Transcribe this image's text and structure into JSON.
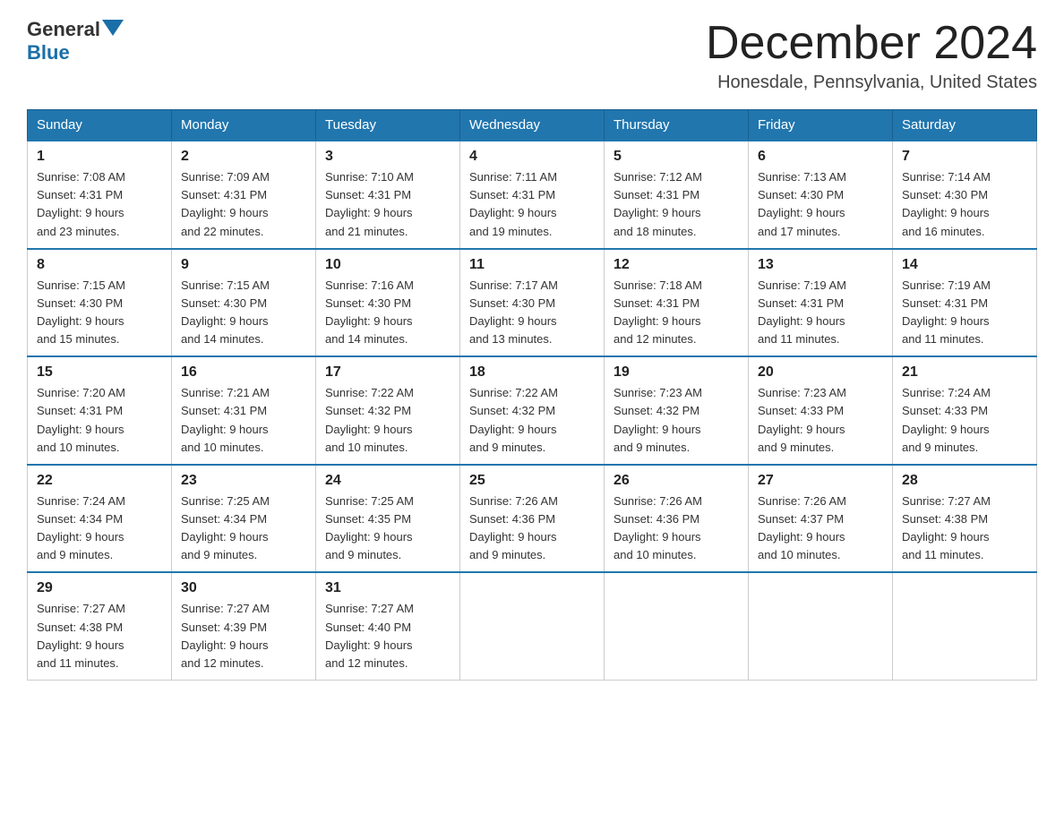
{
  "header": {
    "logo_general": "General",
    "logo_blue": "Blue",
    "title": "December 2024",
    "subtitle": "Honesdale, Pennsylvania, United States"
  },
  "days_of_week": [
    "Sunday",
    "Monday",
    "Tuesday",
    "Wednesday",
    "Thursday",
    "Friday",
    "Saturday"
  ],
  "weeks": [
    [
      {
        "day": "1",
        "sunrise": "7:08 AM",
        "sunset": "4:31 PM",
        "daylight": "9 hours and 23 minutes."
      },
      {
        "day": "2",
        "sunrise": "7:09 AM",
        "sunset": "4:31 PM",
        "daylight": "9 hours and 22 minutes."
      },
      {
        "day": "3",
        "sunrise": "7:10 AM",
        "sunset": "4:31 PM",
        "daylight": "9 hours and 21 minutes."
      },
      {
        "day": "4",
        "sunrise": "7:11 AM",
        "sunset": "4:31 PM",
        "daylight": "9 hours and 19 minutes."
      },
      {
        "day": "5",
        "sunrise": "7:12 AM",
        "sunset": "4:31 PM",
        "daylight": "9 hours and 18 minutes."
      },
      {
        "day": "6",
        "sunrise": "7:13 AM",
        "sunset": "4:30 PM",
        "daylight": "9 hours and 17 minutes."
      },
      {
        "day": "7",
        "sunrise": "7:14 AM",
        "sunset": "4:30 PM",
        "daylight": "9 hours and 16 minutes."
      }
    ],
    [
      {
        "day": "8",
        "sunrise": "7:15 AM",
        "sunset": "4:30 PM",
        "daylight": "9 hours and 15 minutes."
      },
      {
        "day": "9",
        "sunrise": "7:15 AM",
        "sunset": "4:30 PM",
        "daylight": "9 hours and 14 minutes."
      },
      {
        "day": "10",
        "sunrise": "7:16 AM",
        "sunset": "4:30 PM",
        "daylight": "9 hours and 14 minutes."
      },
      {
        "day": "11",
        "sunrise": "7:17 AM",
        "sunset": "4:30 PM",
        "daylight": "9 hours and 13 minutes."
      },
      {
        "day": "12",
        "sunrise": "7:18 AM",
        "sunset": "4:31 PM",
        "daylight": "9 hours and 12 minutes."
      },
      {
        "day": "13",
        "sunrise": "7:19 AM",
        "sunset": "4:31 PM",
        "daylight": "9 hours and 11 minutes."
      },
      {
        "day": "14",
        "sunrise": "7:19 AM",
        "sunset": "4:31 PM",
        "daylight": "9 hours and 11 minutes."
      }
    ],
    [
      {
        "day": "15",
        "sunrise": "7:20 AM",
        "sunset": "4:31 PM",
        "daylight": "9 hours and 10 minutes."
      },
      {
        "day": "16",
        "sunrise": "7:21 AM",
        "sunset": "4:31 PM",
        "daylight": "9 hours and 10 minutes."
      },
      {
        "day": "17",
        "sunrise": "7:22 AM",
        "sunset": "4:32 PM",
        "daylight": "9 hours and 10 minutes."
      },
      {
        "day": "18",
        "sunrise": "7:22 AM",
        "sunset": "4:32 PM",
        "daylight": "9 hours and 9 minutes."
      },
      {
        "day": "19",
        "sunrise": "7:23 AM",
        "sunset": "4:32 PM",
        "daylight": "9 hours and 9 minutes."
      },
      {
        "day": "20",
        "sunrise": "7:23 AM",
        "sunset": "4:33 PM",
        "daylight": "9 hours and 9 minutes."
      },
      {
        "day": "21",
        "sunrise": "7:24 AM",
        "sunset": "4:33 PM",
        "daylight": "9 hours and 9 minutes."
      }
    ],
    [
      {
        "day": "22",
        "sunrise": "7:24 AM",
        "sunset": "4:34 PM",
        "daylight": "9 hours and 9 minutes."
      },
      {
        "day": "23",
        "sunrise": "7:25 AM",
        "sunset": "4:34 PM",
        "daylight": "9 hours and 9 minutes."
      },
      {
        "day": "24",
        "sunrise": "7:25 AM",
        "sunset": "4:35 PM",
        "daylight": "9 hours and 9 minutes."
      },
      {
        "day": "25",
        "sunrise": "7:26 AM",
        "sunset": "4:36 PM",
        "daylight": "9 hours and 9 minutes."
      },
      {
        "day": "26",
        "sunrise": "7:26 AM",
        "sunset": "4:36 PM",
        "daylight": "9 hours and 10 minutes."
      },
      {
        "day": "27",
        "sunrise": "7:26 AM",
        "sunset": "4:37 PM",
        "daylight": "9 hours and 10 minutes."
      },
      {
        "day": "28",
        "sunrise": "7:27 AM",
        "sunset": "4:38 PM",
        "daylight": "9 hours and 11 minutes."
      }
    ],
    [
      {
        "day": "29",
        "sunrise": "7:27 AM",
        "sunset": "4:38 PM",
        "daylight": "9 hours and 11 minutes."
      },
      {
        "day": "30",
        "sunrise": "7:27 AM",
        "sunset": "4:39 PM",
        "daylight": "9 hours and 12 minutes."
      },
      {
        "day": "31",
        "sunrise": "7:27 AM",
        "sunset": "4:40 PM",
        "daylight": "9 hours and 12 minutes."
      },
      null,
      null,
      null,
      null
    ]
  ],
  "labels": {
    "sunrise": "Sunrise:",
    "sunset": "Sunset:",
    "daylight": "Daylight:"
  }
}
